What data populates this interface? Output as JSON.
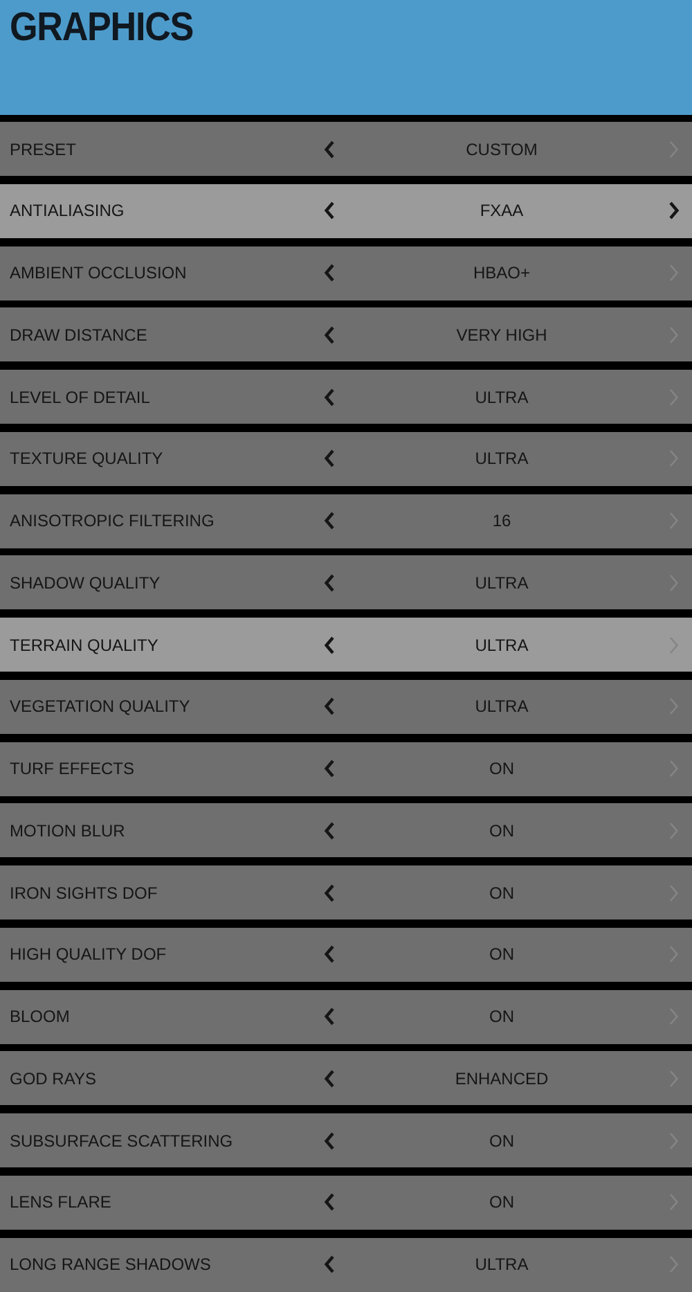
{
  "title": "GRAPHICS",
  "settings": [
    {
      "label": "PRESET",
      "value": "CUSTOM",
      "selected": false,
      "prev_enabled": true,
      "next_enabled": false
    },
    {
      "label": "ANTIALIASING",
      "value": "FXAA",
      "selected": true,
      "prev_enabled": true,
      "next_enabled": true
    },
    {
      "label": "AMBIENT OCCLUSION",
      "value": "HBAO+",
      "selected": false,
      "prev_enabled": true,
      "next_enabled": false
    },
    {
      "label": "DRAW DISTANCE",
      "value": "VERY HIGH",
      "selected": false,
      "prev_enabled": true,
      "next_enabled": false
    },
    {
      "label": "LEVEL OF DETAIL",
      "value": "ULTRA",
      "selected": false,
      "prev_enabled": true,
      "next_enabled": false
    },
    {
      "label": "TEXTURE QUALITY",
      "value": "ULTRA",
      "selected": false,
      "prev_enabled": true,
      "next_enabled": false
    },
    {
      "label": "ANISOTROPIC FILTERING",
      "value": "16",
      "selected": false,
      "prev_enabled": true,
      "next_enabled": false
    },
    {
      "label": "SHADOW QUALITY",
      "value": "ULTRA",
      "selected": false,
      "prev_enabled": true,
      "next_enabled": false
    },
    {
      "label": "TERRAIN QUALITY",
      "value": "ULTRA",
      "selected": true,
      "prev_enabled": true,
      "next_enabled": false
    },
    {
      "label": "VEGETATION QUALITY",
      "value": "ULTRA",
      "selected": false,
      "prev_enabled": true,
      "next_enabled": false
    },
    {
      "label": "TURF EFFECTS",
      "value": "ON",
      "selected": false,
      "prev_enabled": true,
      "next_enabled": false
    },
    {
      "label": "MOTION BLUR",
      "value": "ON",
      "selected": false,
      "prev_enabled": true,
      "next_enabled": false
    },
    {
      "label": "IRON SIGHTS DOF",
      "value": "ON",
      "selected": false,
      "prev_enabled": true,
      "next_enabled": false
    },
    {
      "label": "HIGH QUALITY DOF",
      "value": "ON",
      "selected": false,
      "prev_enabled": true,
      "next_enabled": false
    },
    {
      "label": "BLOOM",
      "value": "ON",
      "selected": false,
      "prev_enabled": true,
      "next_enabled": false
    },
    {
      "label": "GOD RAYS",
      "value": "ENHANCED",
      "selected": false,
      "prev_enabled": true,
      "next_enabled": false
    },
    {
      "label": "SUBSURFACE SCATTERING",
      "value": "ON",
      "selected": false,
      "prev_enabled": true,
      "next_enabled": false
    },
    {
      "label": "LENS FLARE",
      "value": "ON",
      "selected": false,
      "prev_enabled": true,
      "next_enabled": false
    },
    {
      "label": "LONG RANGE SHADOWS",
      "value": "ULTRA",
      "selected": false,
      "prev_enabled": true,
      "next_enabled": false
    }
  ]
}
